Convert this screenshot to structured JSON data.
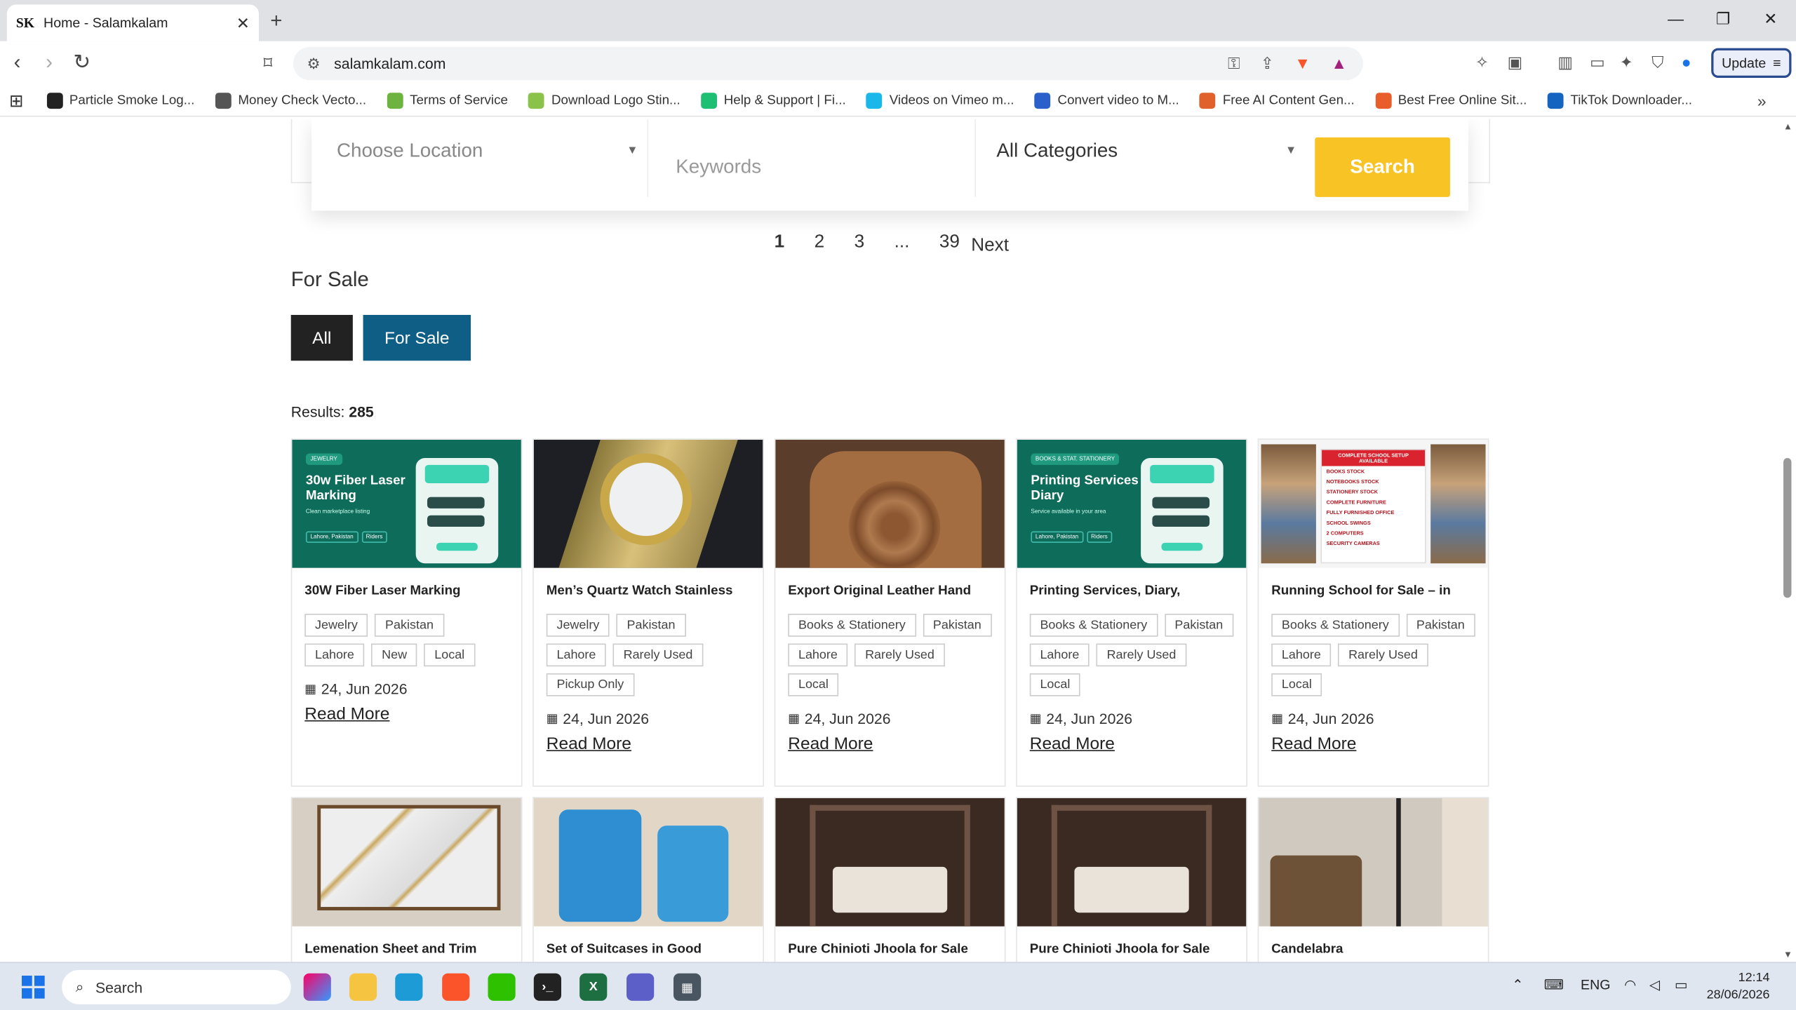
{
  "browser": {
    "tab_title": "Home - Salamkalam",
    "tab_favicon": "SK",
    "url": "salamkalam.com",
    "update_label": "Update"
  },
  "bookmarks": [
    {
      "label": "Particle Smoke Log...",
      "icon": "particle-icon",
      "color": "#222"
    },
    {
      "label": "Money Check Vecto...",
      "icon": "globe-icon",
      "color": "#555"
    },
    {
      "label": "Terms of Service",
      "icon": "px-icon",
      "color": "#6cb33f"
    },
    {
      "label": "Download Logo Stin...",
      "icon": "leaf-icon",
      "color": "#8bc34a"
    },
    {
      "label": "Help & Support | Fi...",
      "icon": "fiverr-icon",
      "color": "#1dbf73"
    },
    {
      "label": "Videos on Vimeo m...",
      "icon": "vimeo-icon",
      "color": "#1ab7ea"
    },
    {
      "label": "Convert video to M...",
      "icon": "hd-icon",
      "color": "#2b5fc9"
    },
    {
      "label": "Free AI Content Gen...",
      "icon": "fox-icon",
      "color": "#e0612b"
    },
    {
      "label": "Best Free Online Sit...",
      "icon": "swirl-icon",
      "color": "#e85d2a"
    },
    {
      "label": "TikTok Downloader...",
      "icon": "t-icon",
      "color": "#1565c0"
    }
  ],
  "search": {
    "location_placeholder": "Choose Location",
    "keywords_placeholder": "Keywords",
    "category_value": "All Categories",
    "button_label": "Search"
  },
  "pagination": {
    "pages": [
      "1",
      "2",
      "3",
      "...",
      "39"
    ],
    "next_label": "Next"
  },
  "section_title": "For Sale",
  "filters": [
    {
      "label": "All",
      "color": "#222222"
    },
    {
      "label": "For Sale",
      "color": "#0f5e85"
    }
  ],
  "results": {
    "label": "Results:",
    "count": "285"
  },
  "cards_row1": [
    {
      "title": "30W Fiber Laser Marking",
      "tags": [
        "Jewelry",
        "Pakistan",
        "Lahore",
        "New",
        "Local"
      ],
      "date": "24, Jun 2026",
      "read_more": "Read More",
      "image": {
        "kind": "promo",
        "pill": "JEWELRY",
        "title": "30w Fiber Laser Marking",
        "sub": "Clean marketplace listing",
        "chips": [
          "Lahore, Pakistan",
          "Riders"
        ]
      }
    },
    {
      "title": "Men’s Quartz Watch Stainless",
      "tags": [
        "Jewelry",
        "Pakistan",
        "Lahore",
        "Rarely Used",
        "Pickup Only"
      ],
      "date": "24, Jun 2026",
      "read_more": "Read More",
      "image": {
        "kind": "watch"
      }
    },
    {
      "title": "Export Original Leather Hand",
      "tags": [
        "Books & Stationery",
        "Pakistan",
        "Lahore",
        "Rarely Used",
        "Local"
      ],
      "date": "24, Jun 2026",
      "read_more": "Read More",
      "image": {
        "kind": "bag"
      }
    },
    {
      "title": "Printing Services, Diary,",
      "tags": [
        "Books & Stationery",
        "Pakistan",
        "Lahore",
        "Rarely Used",
        "Local"
      ],
      "date": "24, Jun 2026",
      "read_more": "Read More",
      "image": {
        "kind": "promo",
        "pill": "BOOKS & STAT. STATIONERY",
        "title": "Printing Services Diary",
        "sub": "Service available in your area",
        "chips": [
          "Lahore, Pakistan",
          "Riders"
        ]
      }
    },
    {
      "title": "Running School for Sale – in",
      "tags": [
        "Books & Stationery",
        "Pakistan",
        "Lahore",
        "Rarely Used",
        "Local"
      ],
      "date": "24, Jun 2026",
      "read_more": "Read More",
      "image": {
        "kind": "school",
        "header": "COMPLETE SCHOOL SETUP AVAILABLE",
        "items": [
          "BOOKS STOCK",
          "NOTEBOOKS STOCK",
          "STATIONERY STOCK",
          "COMPLETE FURNITURE",
          "FULLY FURNISHED OFFICE",
          "SCHOOL SWINGS",
          "2 COMPUTERS",
          "SECURITY CAMERAS"
        ]
      }
    }
  ],
  "cards_row2": [
    {
      "title": "Lemenation Sheet and Trim",
      "image": {
        "kind": "cabinet"
      }
    },
    {
      "title": "Set of Suitcases in Good",
      "image": {
        "kind": "suitcase"
      }
    },
    {
      "title": "Pure Chinioti Jhoola for Sale",
      "image": {
        "kind": "jhoola"
      }
    },
    {
      "title": "Pure Chinioti Jhoola for Sale",
      "image": {
        "kind": "jhoola"
      }
    },
    {
      "title": "Candelabra",
      "image": {
        "kind": "candela"
      }
    }
  ],
  "taskbar": {
    "search_label": "Search",
    "language": "ENG",
    "time": "12:14",
    "date": "28/06/2026"
  },
  "colors": {
    "accent_yellow": "#f7c325",
    "filter_active": "#0f5e85",
    "promo_green": "#0e6c5b"
  }
}
